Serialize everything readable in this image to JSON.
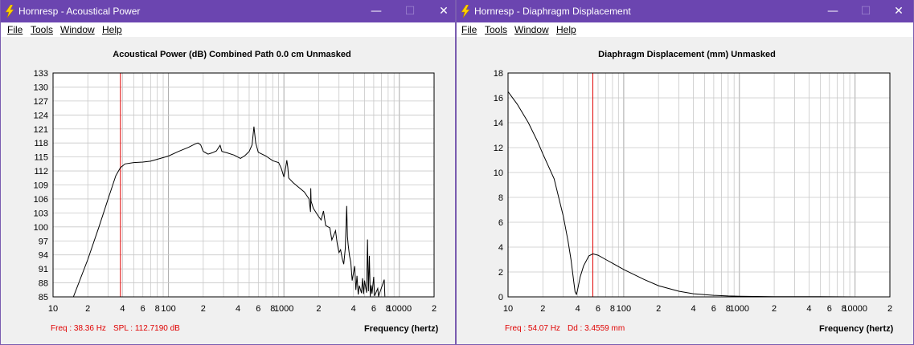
{
  "windows": [
    {
      "title": "Hornresp - Acoustical Power",
      "menu": [
        "File",
        "Tools",
        "Window",
        "Help"
      ],
      "chart_title": "Acoustical Power (dB)   Combined   Path 0.0 cm   Unmasked",
      "readout_freq": "Freq : 38.36 Hz",
      "readout_value": "SPL : 112.7190 dB",
      "x_label": "Frequency (hertz)"
    },
    {
      "title": "Hornresp - Diaphragm Displacement",
      "menu": [
        "File",
        "Tools",
        "Window",
        "Help"
      ],
      "chart_title": "Diaphragm Displacement (mm)   Unmasked",
      "readout_freq": "Freq : 54.07 Hz",
      "readout_value": "Dd : 3.4559 mm",
      "x_label": "Frequency (hertz)"
    }
  ],
  "colors": {
    "titlebar": "#6b45b0",
    "trace": "#000000",
    "cursor": "#e00000",
    "grid": "#c8c8c8"
  },
  "chart_data": [
    {
      "type": "line",
      "title": "Acoustical Power (dB)   Combined   Path 0.0 cm   Unmasked",
      "xlabel": "Frequency (hertz)",
      "ylabel": "",
      "x_scale": "log",
      "xlim": [
        10,
        20000
      ],
      "ylim": [
        85,
        133
      ],
      "y_ticks": [
        85,
        88,
        91,
        94,
        97,
        100,
        103,
        106,
        109,
        112,
        115,
        118,
        121,
        124,
        127,
        130,
        133
      ],
      "x_tick_labels": [
        "10",
        "2",
        "4",
        "6",
        "8",
        "100",
        "2",
        "4",
        "6",
        "8",
        "1000",
        "2",
        "4",
        "6",
        "8",
        "10000",
        "2"
      ],
      "x_tick_values": [
        10,
        20,
        40,
        60,
        80,
        100,
        200,
        400,
        600,
        800,
        1000,
        2000,
        4000,
        6000,
        8000,
        10000,
        20000
      ],
      "cursor_x": 38.36,
      "series": [
        {
          "points": [
            [
              15,
              85
            ],
            [
              20,
              93
            ],
            [
              25,
              100
            ],
            [
              30,
              106
            ],
            [
              35,
              111
            ],
            [
              38.36,
              112.7
            ],
            [
              42,
              113.5
            ],
            [
              50,
              113.8
            ],
            [
              60,
              113.9
            ],
            [
              70,
              114.1
            ],
            [
              80,
              114.5
            ],
            [
              100,
              115.2
            ],
            [
              120,
              116.1
            ],
            [
              150,
              117.1
            ],
            [
              170,
              117.8
            ],
            [
              180,
              118
            ],
            [
              190,
              117.6
            ],
            [
              200,
              116.2
            ],
            [
              220,
              115.6
            ],
            [
              240,
              115.9
            ],
            [
              260,
              116.3
            ],
            [
              280,
              117.5
            ],
            [
              290,
              116.2
            ],
            [
              320,
              115.9
            ],
            [
              370,
              115.4
            ],
            [
              420,
              114.7
            ],
            [
              460,
              115.3
            ],
            [
              500,
              116.2
            ],
            [
              530,
              117.6
            ],
            [
              550,
              121.5
            ],
            [
              570,
              118
            ],
            [
              600,
              116
            ],
            [
              700,
              115.2
            ],
            [
              800,
              114.2
            ],
            [
              900,
              113.8
            ],
            [
              950,
              112.5
            ],
            [
              1000,
              110.7
            ],
            [
              1040,
              113
            ],
            [
              1060,
              114.3
            ],
            [
              1080,
              112.8
            ],
            [
              1100,
              110.5
            ],
            [
              1200,
              109.5
            ],
            [
              1300,
              108.8
            ],
            [
              1500,
              107.5
            ],
            [
              1650,
              106
            ],
            [
              1700,
              103.2
            ],
            [
              1710,
              108.3
            ],
            [
              1720,
              105.5
            ],
            [
              1800,
              104
            ],
            [
              2000,
              102.2
            ],
            [
              2100,
              101.5
            ],
            [
              2200,
              103.4
            ],
            [
              2300,
              100.3
            ],
            [
              2500,
              99.8
            ],
            [
              2600,
              97.2
            ],
            [
              2800,
              99.2
            ],
            [
              2900,
              96.3
            ],
            [
              3000,
              94.5
            ],
            [
              3100,
              95.1
            ],
            [
              3200,
              93.2
            ],
            [
              3300,
              92
            ],
            [
              3400,
              95.3
            ],
            [
              3500,
              104.5
            ],
            [
              3550,
              98
            ],
            [
              3600,
              96.2
            ],
            [
              3700,
              93.8
            ],
            [
              3800,
              92.4
            ],
            [
              3900,
              88.5
            ],
            [
              4100,
              91.6
            ],
            [
              4200,
              86.5
            ],
            [
              4300,
              89.5
            ],
            [
              4400,
              85.5
            ],
            [
              4500,
              87.4
            ],
            [
              4700,
              85.8
            ],
            [
              4800,
              89
            ],
            [
              4900,
              85.6
            ],
            [
              5000,
              88.5
            ],
            [
              5200,
              85.9
            ],
            [
              5300,
              97.3
            ],
            [
              5400,
              86.2
            ],
            [
              5500,
              93.8
            ],
            [
              5600,
              85.1
            ],
            [
              5700,
              87.5
            ],
            [
              5800,
              85.7
            ],
            [
              6000,
              89.3
            ],
            [
              6100,
              85.2
            ],
            [
              6500,
              86.8
            ],
            [
              6600,
              85.1
            ],
            [
              7400,
              88.7
            ],
            [
              7500,
              85.1
            ]
          ]
        }
      ]
    },
    {
      "type": "line",
      "title": "Diaphragm Displacement (mm)   Unmasked",
      "xlabel": "Frequency (hertz)",
      "ylabel": "",
      "x_scale": "log",
      "xlim": [
        10,
        20000
      ],
      "ylim": [
        0,
        18
      ],
      "y_ticks": [
        0,
        2,
        4,
        6,
        8,
        10,
        12,
        14,
        16,
        18
      ],
      "x_tick_labels": [
        "10",
        "2",
        "4",
        "6",
        "8",
        "100",
        "2",
        "4",
        "6",
        "8",
        "1000",
        "2",
        "4",
        "6",
        "8",
        "10000",
        "2"
      ],
      "x_tick_values": [
        10,
        20,
        40,
        60,
        80,
        100,
        200,
        400,
        600,
        800,
        1000,
        2000,
        4000,
        6000,
        8000,
        10000,
        20000
      ],
      "cursor_x": 54.07,
      "series": [
        {
          "points": [
            [
              10,
              16.5
            ],
            [
              12,
              15.5
            ],
            [
              15,
              14
            ],
            [
              18,
              12.5
            ],
            [
              20,
              11.5
            ],
            [
              25,
              9.5
            ],
            [
              30,
              6.5
            ],
            [
              33,
              4.5
            ],
            [
              35,
              3
            ],
            [
              37,
              1.2
            ],
            [
              38,
              0.4
            ],
            [
              39,
              0.2
            ],
            [
              40,
              0.6
            ],
            [
              42,
              1.6
            ],
            [
              45,
              2.5
            ],
            [
              50,
              3.3
            ],
            [
              54.07,
              3.46
            ],
            [
              60,
              3.35
            ],
            [
              70,
              3
            ],
            [
              80,
              2.7
            ],
            [
              100,
              2.2
            ],
            [
              150,
              1.4
            ],
            [
              200,
              0.9
            ],
            [
              300,
              0.45
            ],
            [
              400,
              0.25
            ],
            [
              600,
              0.12
            ],
            [
              800,
              0.07
            ],
            [
              1000,
              0.05
            ],
            [
              2000,
              0.02
            ],
            [
              5000,
              0.01
            ],
            [
              10000,
              0
            ],
            [
              20000,
              0
            ]
          ]
        }
      ]
    }
  ]
}
